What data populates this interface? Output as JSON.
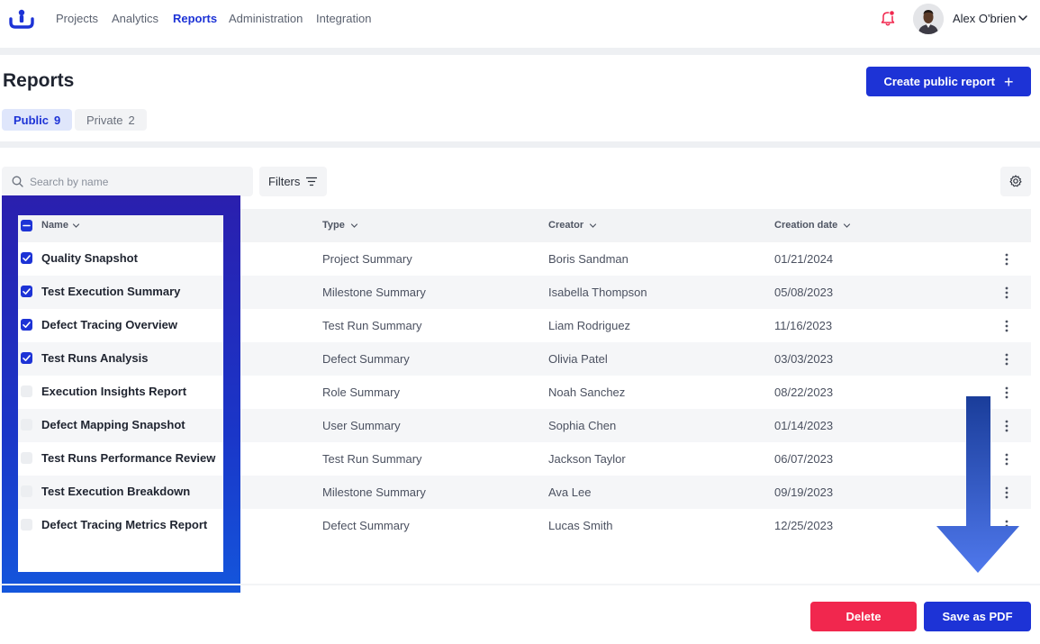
{
  "nav": {
    "items": [
      {
        "label": "Projects",
        "active": false
      },
      {
        "label": "Analytics",
        "active": false
      },
      {
        "label": "Reports",
        "active": true
      },
      {
        "label": "Administration",
        "active": false
      },
      {
        "label": "Integration",
        "active": false
      }
    ],
    "user_name": "Alex O'brien",
    "notification_badge_color": "#f1274e"
  },
  "page": {
    "title": "Reports",
    "create_button_label": "Create public report",
    "create_button_icon": "plus-icon"
  },
  "tabs": [
    {
      "label": "Public",
      "count": "9",
      "selected": true
    },
    {
      "label": "Private",
      "count": "2",
      "selected": false
    }
  ],
  "toolbar": {
    "search_placeholder": "Search by name",
    "search_value": "",
    "filters_label": "Filters",
    "settings_icon": "gear-icon"
  },
  "table": {
    "columns": [
      "Name",
      "Type",
      "Creator",
      "Creation date"
    ],
    "header_checkbox_state": "indeterminate",
    "rows": [
      {
        "checked": true,
        "name": "Quality Snapshot",
        "type": "Project Summary",
        "creator": "Boris Sandman",
        "date": "01/21/2024"
      },
      {
        "checked": true,
        "name": "Test Execution Summary",
        "type": "Milestone Summary",
        "creator": "Isabella Thompson",
        "date": "05/08/2023"
      },
      {
        "checked": true,
        "name": "Defect Tracing Overview",
        "type": "Test Run Summary",
        "creator": "Liam Rodriguez",
        "date": "11/16/2023"
      },
      {
        "checked": true,
        "name": "Test Runs Analysis",
        "type": "Defect Summary",
        "creator": "Olivia Patel",
        "date": "03/03/2023"
      },
      {
        "checked": false,
        "name": "Execution Insights Report",
        "type": "Role Summary",
        "creator": "Noah Sanchez",
        "date": "08/22/2023"
      },
      {
        "checked": false,
        "name": "Defect Mapping Snapshot",
        "type": "User Summary",
        "creator": "Sophia Chen",
        "date": "01/14/2023"
      },
      {
        "checked": false,
        "name": "Test Runs Performance Review",
        "type": "Test Run Summary",
        "creator": "Jackson Taylor",
        "date": "06/07/2023"
      },
      {
        "checked": false,
        "name": "Test Execution Breakdown",
        "type": "Milestone Summary",
        "creator": "Ava Lee",
        "date": "09/19/2023"
      },
      {
        "checked": false,
        "name": "Defect Tracing Metrics Report",
        "type": "Defect Summary",
        "creator": "Lucas Smith",
        "date": "12/25/2023"
      }
    ]
  },
  "footer": {
    "delete_label": "Delete",
    "save_pdf_label": "Save as PDF"
  },
  "colors": {
    "accent": "#1d33d6",
    "danger": "#f1274e",
    "highlight_frame": "#2a1fae",
    "arrow": "#4f78ec"
  }
}
